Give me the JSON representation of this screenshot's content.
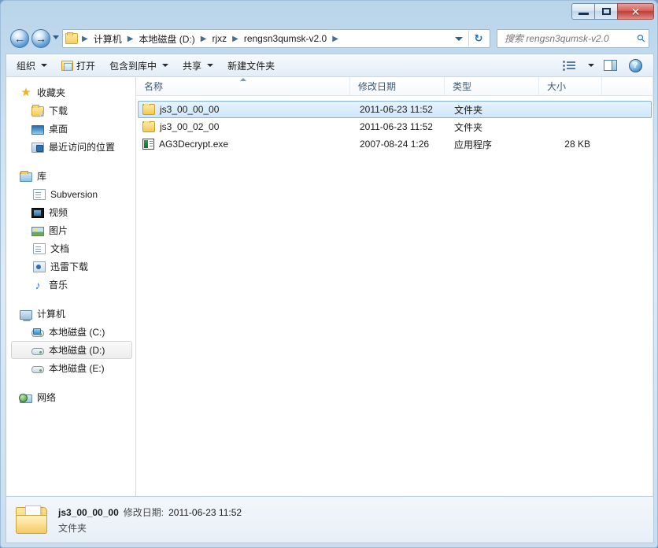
{
  "window": {
    "controls": {
      "minimize": "minimize",
      "maximize": "maximize",
      "close": "✕"
    }
  },
  "nav": {
    "back_glyph": "←",
    "forward_glyph": "→",
    "refresh_glyph": "↻",
    "breadcrumb": [
      {
        "label": "计算机"
      },
      {
        "label": "本地磁盘 (D:)"
      },
      {
        "label": "rjxz"
      },
      {
        "label": "rengsn3qumsk-v2.0"
      }
    ],
    "separator": "▶"
  },
  "search": {
    "placeholder": "搜索 rengsn3qumsk-v2.0",
    "value": "",
    "icon": "search-icon"
  },
  "toolbar": {
    "organize_label": "组织",
    "open_label": "打开",
    "include_library_label": "包含到库中",
    "share_label": "共享",
    "new_folder_label": "新建文件夹",
    "view_icon": "view-list-icon",
    "preview_pane_icon": "preview-pane-icon",
    "help_icon": "help-icon",
    "help_glyph": "?"
  },
  "sidebar": {
    "groups": [
      {
        "head": {
          "label": "收藏夹",
          "icon": "star-icon"
        },
        "items": [
          {
            "label": "下载",
            "icon": "downloads-folder-icon"
          },
          {
            "label": "桌面",
            "icon": "desktop-icon"
          },
          {
            "label": "最近访问的位置",
            "icon": "recent-places-icon"
          }
        ]
      },
      {
        "head": {
          "label": "库",
          "icon": "libraries-icon"
        },
        "items": [
          {
            "label": "Subversion",
            "icon": "document-library-icon"
          },
          {
            "label": "视频",
            "icon": "video-library-icon"
          },
          {
            "label": "图片",
            "icon": "pictures-library-icon"
          },
          {
            "label": "文档",
            "icon": "documents-library-icon"
          },
          {
            "label": "迅雷下载",
            "icon": "thunder-download-icon"
          },
          {
            "label": "音乐",
            "icon": "music-library-icon"
          }
        ]
      },
      {
        "head": {
          "label": "计算机",
          "icon": "computer-icon"
        },
        "items": [
          {
            "label": "本地磁盘 (C:)",
            "icon": "system-drive-icon",
            "selected": false
          },
          {
            "label": "本地磁盘 (D:)",
            "icon": "drive-icon",
            "selected": true
          },
          {
            "label": "本地磁盘 (E:)",
            "icon": "drive-icon",
            "selected": false
          }
        ]
      },
      {
        "head": {
          "label": "网络",
          "icon": "network-icon"
        },
        "items": []
      }
    ]
  },
  "filelist": {
    "columns": [
      {
        "key": "name",
        "label": "名称",
        "sorted": true
      },
      {
        "key": "date",
        "label": "修改日期",
        "sorted": false
      },
      {
        "key": "type",
        "label": "类型",
        "sorted": false
      },
      {
        "key": "size",
        "label": "大小",
        "sorted": false
      }
    ],
    "rows": [
      {
        "name": "js3_00_00_00",
        "date": "2011-06-23 11:52",
        "type": "文件夹",
        "size": "",
        "icon": "folder-icon",
        "selected": true
      },
      {
        "name": "js3_00_02_00",
        "date": "2011-06-23 11:52",
        "type": "文件夹",
        "size": "",
        "icon": "folder-icon",
        "selected": false
      },
      {
        "name": "AG3Decrypt.exe",
        "date": "2007-08-24 1:26",
        "type": "应用程序",
        "size": "28 KB",
        "icon": "exe-icon",
        "selected": false
      }
    ]
  },
  "details": {
    "icon": "folder-large-icon",
    "name": "js3_00_00_00",
    "date_label": "修改日期:",
    "date_value": "2011-06-23 11:52",
    "type": "文件夹"
  },
  "colors": {
    "accent": "#2b6fb5",
    "selection": "#cfe6fa",
    "selection_border": "#7fb5e0",
    "folder_yellow": "#f2c94f",
    "close_red": "#bc3d36",
    "titlebar_blue": "#cfe2f2"
  }
}
